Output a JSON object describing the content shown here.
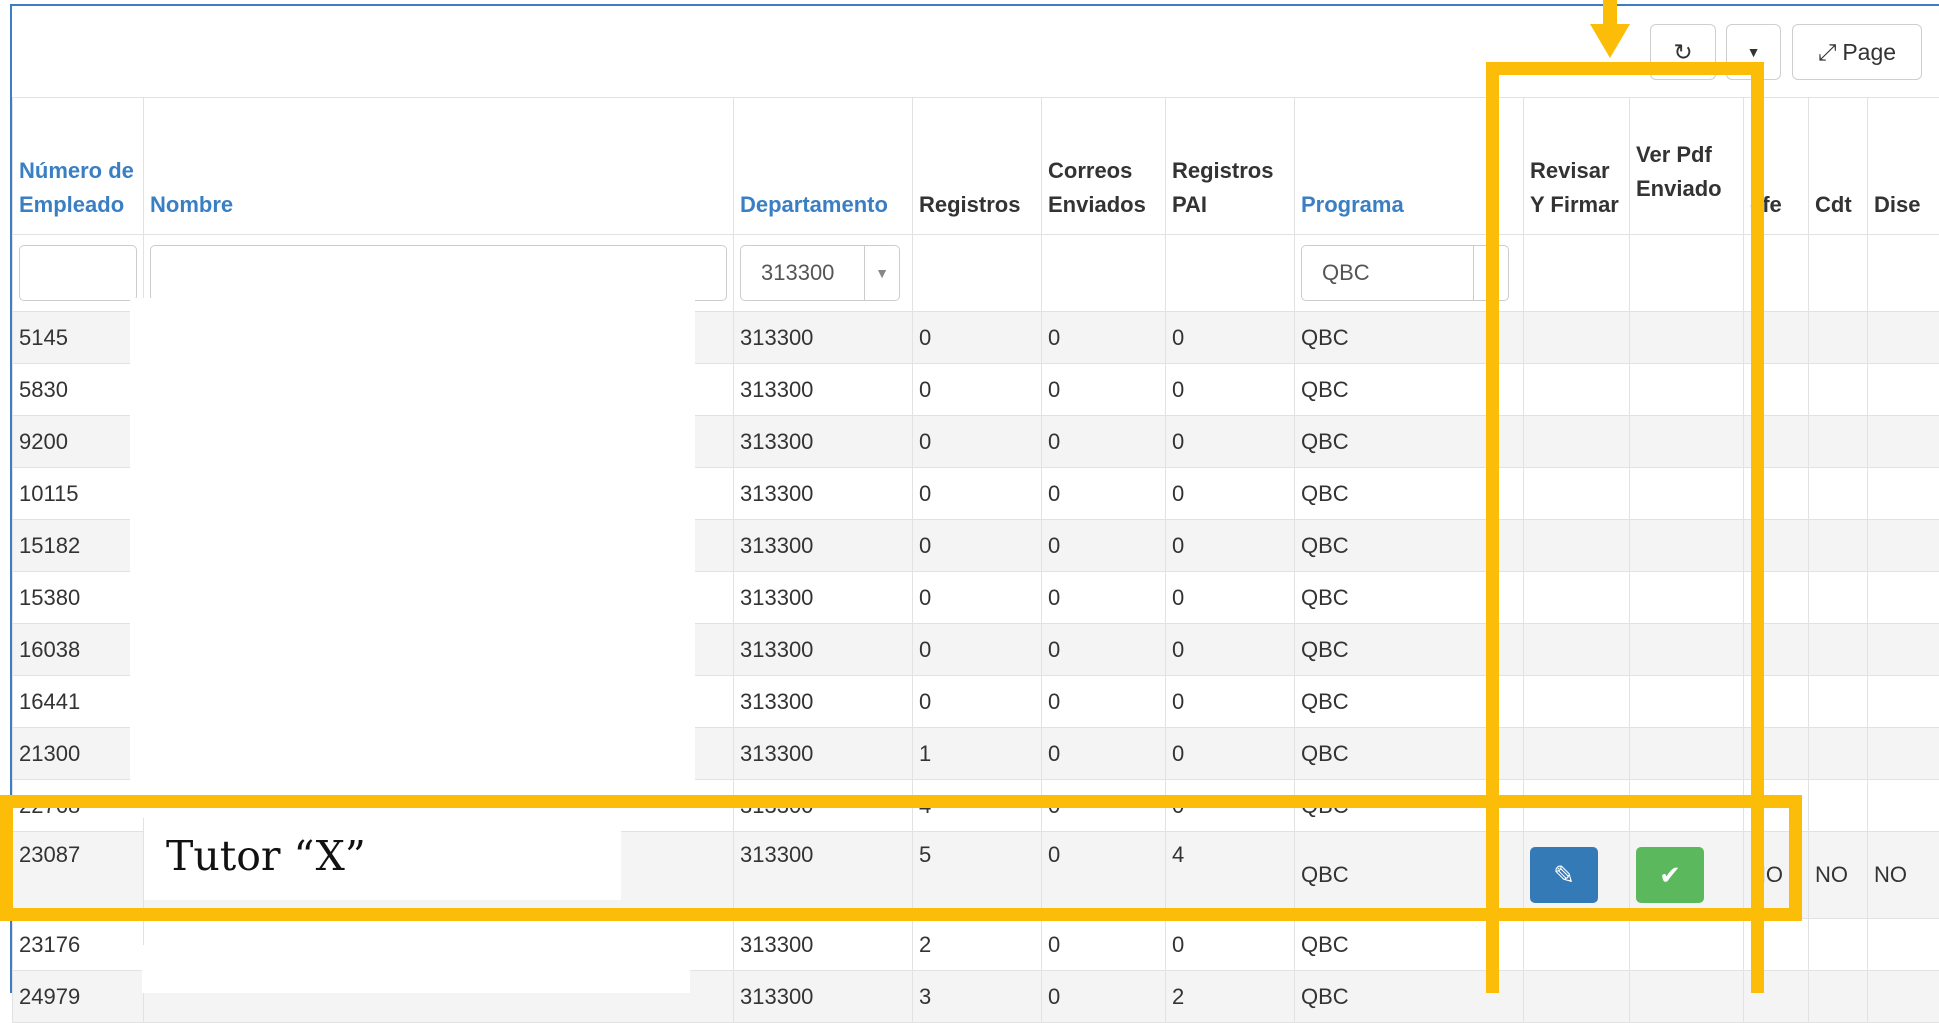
{
  "toolbar": {
    "refresh_icon": "refresh-icon",
    "dropdown_icon": "caret-down-icon",
    "page_label": "Page",
    "page_icon": "compress-icon"
  },
  "columns": [
    {
      "key": "num",
      "label": "Número de Empleado",
      "sortable": true
    },
    {
      "key": "nombre",
      "label": "Nombre",
      "sortable": true
    },
    {
      "key": "depto",
      "label": "Departamento",
      "sortable": true
    },
    {
      "key": "registros",
      "label": "Registros",
      "sortable": false
    },
    {
      "key": "correos",
      "label": "Correos Enviados",
      "sortable": false
    },
    {
      "key": "pai",
      "label": "Registros PAI",
      "sortable": false
    },
    {
      "key": "programa",
      "label": "Programa",
      "sortable": true
    },
    {
      "key": "revisar",
      "label": "Revisar Y Firmar",
      "sortable": false
    },
    {
      "key": "verpdf",
      "label": "Ver Pdf Enviado",
      "sortable": false
    },
    {
      "key": "jefe",
      "label": "efe",
      "sortable": false
    },
    {
      "key": "cdt",
      "label": "Cdt",
      "sortable": false
    },
    {
      "key": "dise",
      "label": "Dise",
      "sortable": false
    }
  ],
  "filters": {
    "departamento": "313300",
    "programa": "QBC"
  },
  "rows": [
    {
      "num": "5145",
      "depto": "313300",
      "registros": "0",
      "correos": "0",
      "pai": "0",
      "programa": "QBC"
    },
    {
      "num": "5830",
      "depto": "313300",
      "registros": "0",
      "correos": "0",
      "pai": "0",
      "programa": "QBC"
    },
    {
      "num": "9200",
      "depto": "313300",
      "registros": "0",
      "correos": "0",
      "pai": "0",
      "programa": "QBC"
    },
    {
      "num": "10115",
      "depto": "313300",
      "registros": "0",
      "correos": "0",
      "pai": "0",
      "programa": "QBC"
    },
    {
      "num": "15182",
      "depto": "313300",
      "registros": "0",
      "correos": "0",
      "pai": "0",
      "programa": "QBC"
    },
    {
      "num": "15380",
      "depto": "313300",
      "registros": "0",
      "correos": "0",
      "pai": "0",
      "programa": "QBC"
    },
    {
      "num": "16038",
      "depto": "313300",
      "registros": "0",
      "correos": "0",
      "pai": "0",
      "programa": "QBC"
    },
    {
      "num": "16441",
      "depto": "313300",
      "registros": "0",
      "correos": "0",
      "pai": "0",
      "programa": "QBC"
    },
    {
      "num": "21300",
      "depto": "313300",
      "registros": "1",
      "correos": "0",
      "pai": "0",
      "programa": "QBC"
    },
    {
      "num": "22768",
      "depto": "313300",
      "registros": "4",
      "correos": "0",
      "pai": "0",
      "programa": "QBC"
    },
    {
      "num": "23087",
      "depto": "313300",
      "registros": "5",
      "correos": "0",
      "pai": "4",
      "programa": "QBC",
      "jefe": "NO",
      "cdt": "NO",
      "dise": "NO",
      "has_actions": true
    },
    {
      "num": "23176",
      "depto": "313300",
      "registros": "2",
      "correos": "0",
      "pai": "0",
      "programa": "QBC"
    },
    {
      "num": "24979",
      "depto": "313300",
      "registros": "3",
      "correos": "0",
      "pai": "2",
      "programa": "QBC"
    }
  ],
  "annotation": {
    "tutor_label": "Tutor “X”",
    "color": "#fbbd08"
  },
  "colors": {
    "accent": "#3a7fc4",
    "btn_primary": "#337ab7",
    "btn_success": "#5cb85c"
  }
}
